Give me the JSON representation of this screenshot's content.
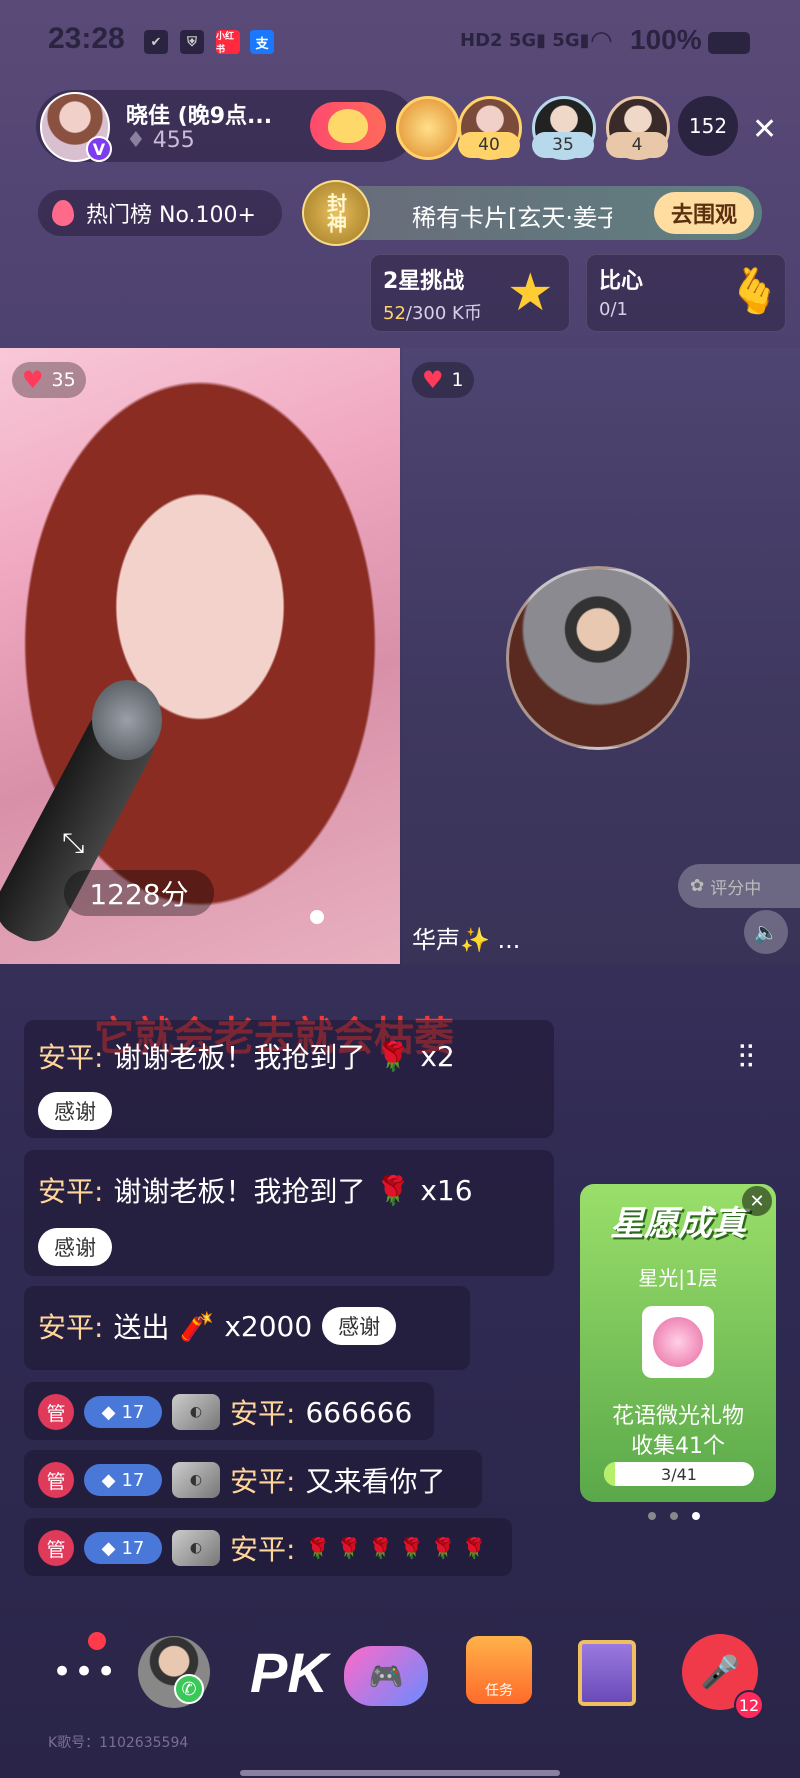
{
  "status": {
    "time": "23:28",
    "battery": "100%",
    "signals": [
      "HD2",
      "5G",
      "5G"
    ],
    "app_icons": [
      "check-icon",
      "shield-icon",
      "xiaohongshu-icon",
      "alipay-icon"
    ]
  },
  "host": {
    "name": "晓佳 (晚9点...",
    "score": "455",
    "follow_icon": "heart-gold-icon"
  },
  "rank": [
    {
      "badge": "40",
      "color": "#ffd36a"
    },
    {
      "badge": "35",
      "color": "#b8d8ec"
    },
    {
      "badge": "4",
      "color": "#e8c8a8"
    }
  ],
  "viewers": "152",
  "hot": {
    "label": "热门榜 No.100+"
  },
  "card_banner": {
    "seal": "封神",
    "text": "稀有卡片[玄天·姜子",
    "button": "去围观"
  },
  "challenges": [
    {
      "title": "2星挑战",
      "progress": "52/300 K币",
      "current": "52"
    },
    {
      "title": "比心",
      "progress": "0/1"
    }
  ],
  "video": {
    "left_likes": "35",
    "right_likes": "1",
    "score": "1228分",
    "guest_name": "华声✨ ...",
    "scoring_label": "评分中"
  },
  "lyric": "它就会老去就会枯萎",
  "chat": [
    {
      "nick": "安平:",
      "text": "谢谢老板！我抢到了",
      "gift": "🌹",
      "count": "x2",
      "thank": "感谢"
    },
    {
      "nick": "安平:",
      "text": "谢谢老板！我抢到了",
      "gift": "🌹",
      "count": "x16",
      "thank": "感谢"
    },
    {
      "nick": "安平:",
      "text": "送出",
      "gift": "🧨",
      "count": "x2000",
      "thank": "感谢"
    },
    {
      "role": "管",
      "level": "17",
      "nick": "安平:",
      "text": "666666"
    },
    {
      "role": "管",
      "level": "17",
      "nick": "安平:",
      "text": "又来看你了"
    },
    {
      "role": "管",
      "level": "17",
      "nick": "安平:",
      "text": "🌹 🌹 🌹 🌹 🌹 🌹"
    }
  ],
  "wish": {
    "title": "星愿成真",
    "subtitle": "星光|1层",
    "desc_line1": "花语微光礼物",
    "desc_line2": "收集41个",
    "progress": "3/41",
    "progress_fraction": 0.073
  },
  "bottom": {
    "pk": "PK",
    "task_label": "任务",
    "mic_count": "12",
    "kid": "K歌号：1102635594"
  }
}
